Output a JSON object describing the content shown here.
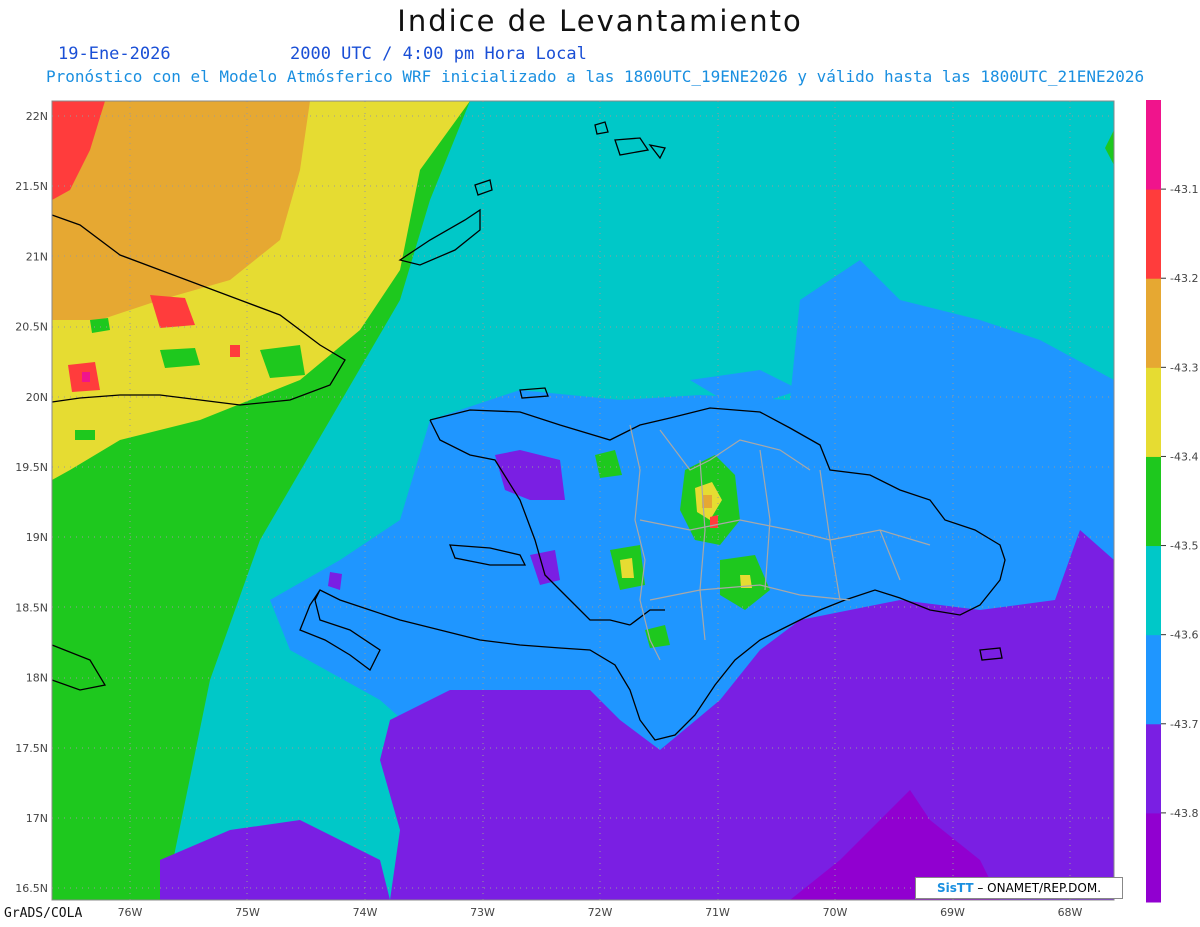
{
  "header": {
    "title": "Indice de Levantamiento",
    "date": "19-Ene-2026",
    "time": "2000 UTC / 4:00 pm Hora Local",
    "subtitle": "Pronóstico con el Modelo Atmósferico WRF inicializado a las 1800UTC_19ENE2026 y válido hasta las  1800UTC_21ENE2026"
  },
  "axes": {
    "lat_labels": [
      "22N",
      "21.5N",
      "21N",
      "20.5N",
      "20N",
      "19.5N",
      "19N",
      "18.5N",
      "18N",
      "17.5N",
      "17N",
      "16.5N"
    ],
    "lon_labels": [
      "76W",
      "75W",
      "74W",
      "73W",
      "72W",
      "71W",
      "70W",
      "69W",
      "68W"
    ]
  },
  "colorbar": {
    "labels": [
      "-43.1",
      "-43.2",
      "-43.3",
      "-43.4",
      "-43.5",
      "-43.6",
      "-43.7",
      "-43.8"
    ],
    "colors": [
      "#9100d0",
      "#7a1fe3",
      "#1f96ff",
      "#00c8c8",
      "#1ec81e",
      "#e6dc32",
      "#e6a832",
      "#ff3c3c",
      "#f0148c"
    ]
  },
  "credit": {
    "brand": "SisTT",
    "org": "– ONAMET/REP.DOM."
  },
  "footer": {
    "software": "GrADS/COLA"
  }
}
